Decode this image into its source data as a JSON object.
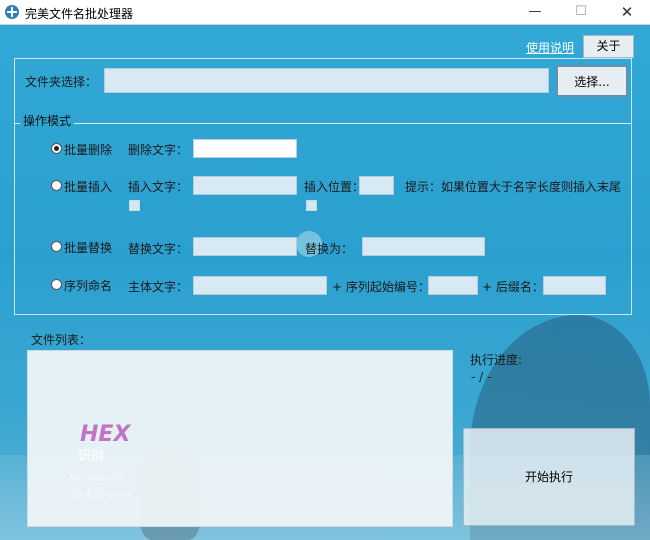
{
  "window": {
    "title": "完美文件名批处理器",
    "minimize_symbol": "—",
    "maximize_symbol": "☐",
    "close_symbol": "✕"
  },
  "header": {
    "help_link": "使用说明",
    "about_button": "关于"
  },
  "folder": {
    "label": "文件夹选择：",
    "value": "",
    "select_button": "选择..."
  },
  "operation_mode": {
    "group_title": "操作模式",
    "selected": "batch_delete",
    "batch_delete": {
      "radio_label": "批量删除",
      "text_label": "删除文字：",
      "text_value": ""
    },
    "batch_insert": {
      "radio_label": "批量插入",
      "text_label": "插入文字：",
      "text_value": "",
      "position_label": "插入位置：",
      "position_value": "",
      "hint": "提示：如果位置大于名字长度则插入末尾"
    },
    "batch_replace": {
      "radio_label": "批量替换",
      "find_label": "替换文字：",
      "find_value": "",
      "replace_label": "替换为：",
      "replace_value": ""
    },
    "sequence_rename": {
      "radio_label": "序列命名",
      "base_label": "主体文字：",
      "base_value": "",
      "start_label": "+ 序列起始编号：",
      "start_value": "",
      "suffix_label": "+ 后缀名：",
      "suffix_value": ""
    }
  },
  "file_list": {
    "label": "文件列表："
  },
  "progress": {
    "label": "执行进度:",
    "value": "- / -"
  },
  "start_button": "开始执行",
  "watermark": {
    "logo": "HEX",
    "logo_sub": "识别",
    "line1": "WinHex(C...",
    "line2": "技术网www..."
  },
  "colors": {
    "background": "#2ea6d4",
    "titlebar": "#ffffff"
  }
}
